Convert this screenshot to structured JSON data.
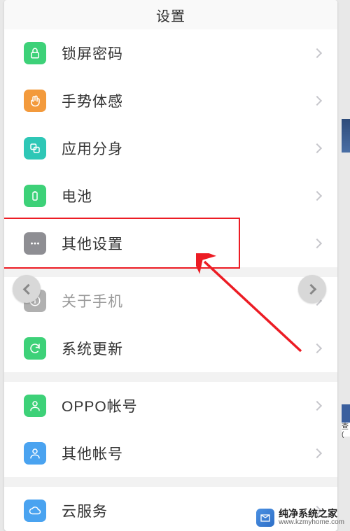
{
  "header": {
    "title": "设置"
  },
  "groups": [
    {
      "items": [
        {
          "key": "lockscreen",
          "label": "锁屏密码",
          "icon": "lock-icon",
          "bg": "#3dd178",
          "glyph": "lock"
        },
        {
          "key": "gesture",
          "label": "手势体感",
          "icon": "gesture-icon",
          "bg": "#f39a3c",
          "glyph": "hand"
        },
        {
          "key": "appclone",
          "label": "应用分身",
          "icon": "appclone-icon",
          "bg": "#2ec7b6",
          "glyph": "clone"
        },
        {
          "key": "battery",
          "label": "电池",
          "icon": "battery-icon",
          "bg": "#3dd178",
          "glyph": "battery"
        },
        {
          "key": "other",
          "label": "其他设置",
          "icon": "other-icon",
          "bg": "#8e8e93",
          "glyph": "dots",
          "highlighted": true
        }
      ]
    },
    {
      "items": [
        {
          "key": "about",
          "label": "关于手机",
          "icon": "about-icon",
          "bg": "#b0b0b0",
          "glyph": "info",
          "dim": true
        },
        {
          "key": "update",
          "label": "系统更新",
          "icon": "update-icon",
          "bg": "#3dd178",
          "glyph": "refresh"
        }
      ]
    },
    {
      "items": [
        {
          "key": "oppo",
          "label": "OPPO帐号",
          "icon": "oppo-account-icon",
          "bg": "#3dd178",
          "glyph": "person"
        },
        {
          "key": "other-account",
          "label": "其他帐号",
          "icon": "other-account-icon",
          "bg": "#4aa3f0",
          "glyph": "person"
        }
      ]
    },
    {
      "items": [
        {
          "key": "cloud",
          "label": "云服务",
          "icon": "cloud-icon",
          "bg": "#4aa3f0",
          "glyph": "cloud"
        }
      ]
    }
  ],
  "nav": {
    "prev": "prev",
    "next": "next"
  },
  "watermark": {
    "name": "纯净系统之家",
    "url": "www.kzmyhome.com"
  },
  "sidebar_tag": "查("
}
